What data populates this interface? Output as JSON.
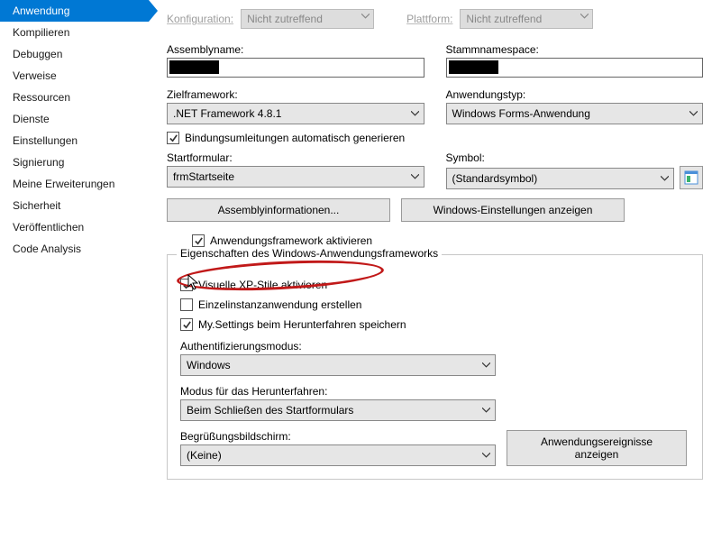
{
  "sidebar": {
    "items": [
      {
        "label": "Anwendung",
        "active": true
      },
      {
        "label": "Kompilieren"
      },
      {
        "label": "Debuggen"
      },
      {
        "label": "Verweise"
      },
      {
        "label": "Ressourcen"
      },
      {
        "label": "Dienste"
      },
      {
        "label": "Einstellungen"
      },
      {
        "label": "Signierung"
      },
      {
        "label": "Meine Erweiterungen"
      },
      {
        "label": "Sicherheit"
      },
      {
        "label": "Veröffentlichen"
      },
      {
        "label": "Code Analysis"
      }
    ]
  },
  "top": {
    "config_label": "Konfiguration:",
    "config_value": "Nicht zutreffend",
    "platform_label": "Plattform:",
    "platform_value": "Nicht zutreffend"
  },
  "fields": {
    "assembly_name_label": "Assemblyname:",
    "root_ns_label": "Stammnamespace:",
    "target_fw_label": "Zielframework:",
    "target_fw_value": ".NET Framework 4.8.1",
    "app_type_label": "Anwendungstyp:",
    "app_type_value": "Windows Forms-Anwendung",
    "binding_redirect_label": "Bindungsumleitungen automatisch generieren",
    "binding_redirect_checked": true,
    "start_form_label": "Startformular:",
    "start_form_value": "frmStartseite",
    "symbol_label": "Symbol:",
    "symbol_value": "(Standardsymbol)"
  },
  "buttons": {
    "assembly_info": "Assemblyinformationen...",
    "windows_settings": "Windows-Einstellungen anzeigen",
    "events": "Anwendungsereignisse anzeigen"
  },
  "app_fw": {
    "enable_label": "Anwendungsframework aktivieren",
    "enable_checked": true,
    "group_title": "Eigenschaften des Windows-Anwendungsframeworks",
    "xp_styles_label": "Visuelle XP-Stile aktivieren",
    "xp_styles_checked": true,
    "single_instance_label": "Einzelinstanzanwendung erstellen",
    "single_instance_checked": false,
    "save_settings_label": "My.Settings beim Herunterfahren speichern",
    "save_settings_checked": true,
    "auth_mode_label": "Authentifizierungsmodus:",
    "auth_mode_value": "Windows",
    "shutdown_mode_label": "Modus für das Herunterfahren:",
    "shutdown_mode_value": "Beim Schließen des Startformulars",
    "splash_label": "Begrüßungsbildschirm:",
    "splash_value": "(Keine)"
  }
}
